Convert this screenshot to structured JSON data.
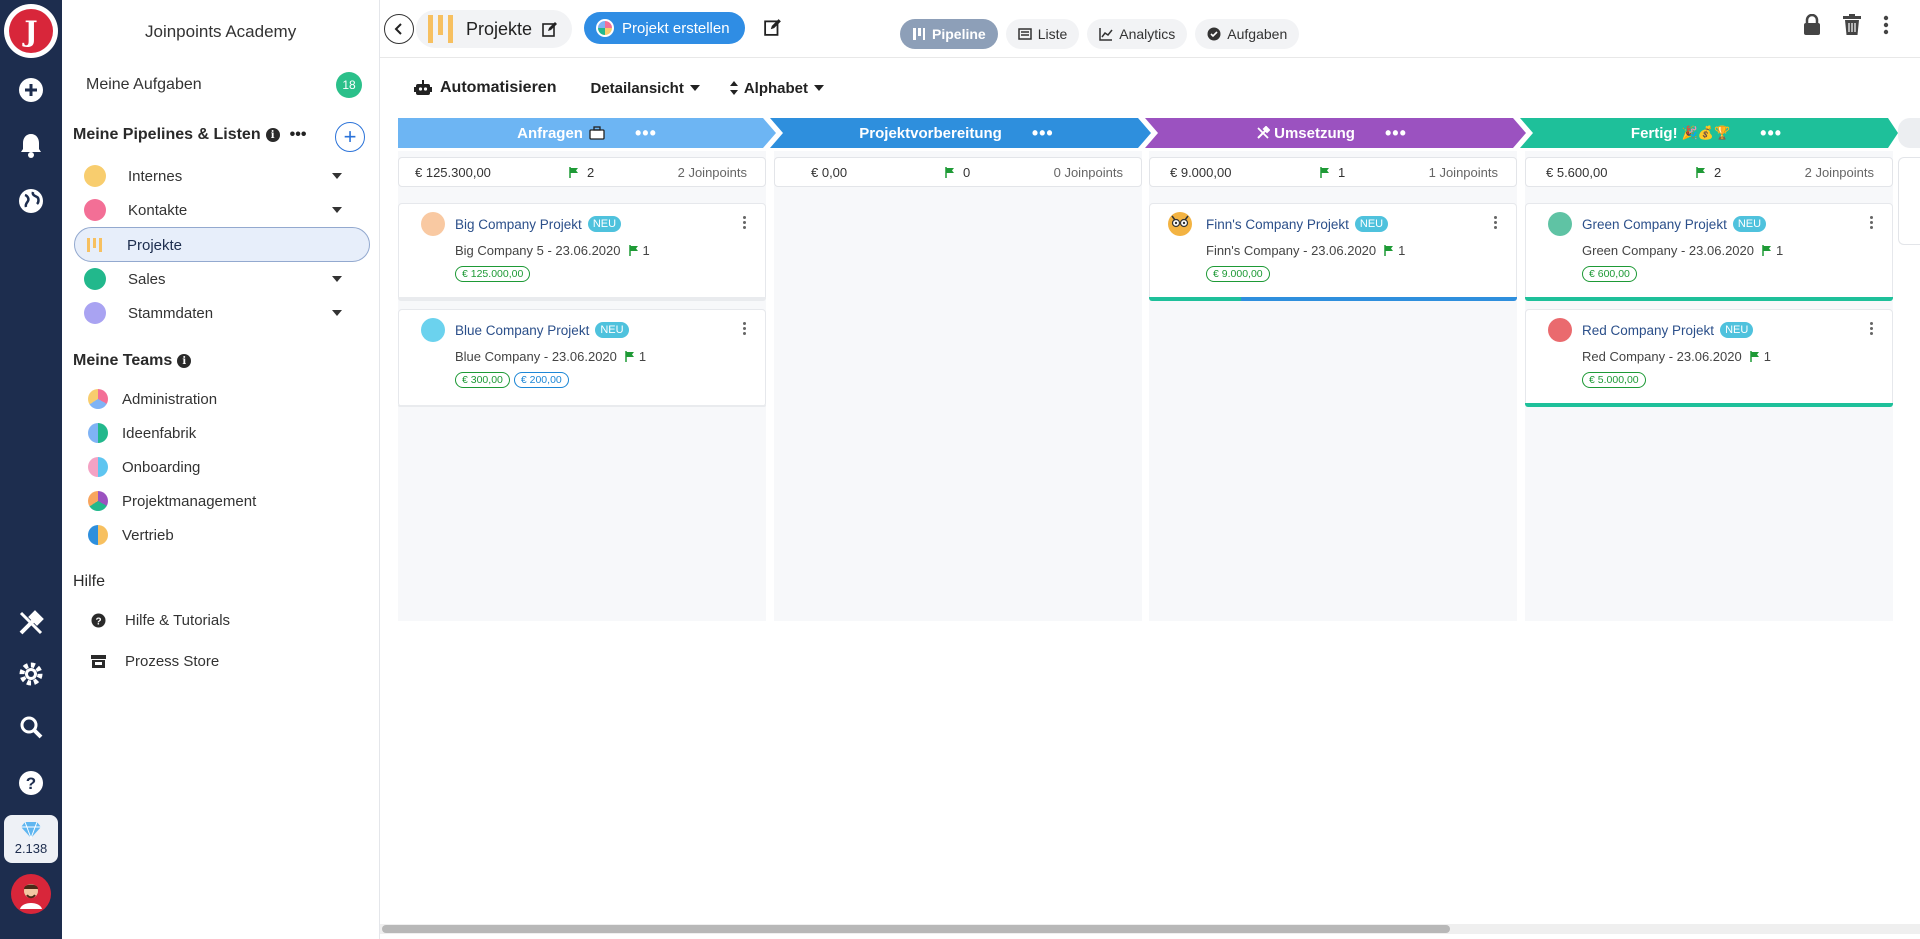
{
  "app": {
    "title": "Joinpoints Academy",
    "credits": "2.138"
  },
  "sidebar": {
    "my_tasks": {
      "label": "Meine Aufgaben",
      "count": "18"
    },
    "pipelines_heading": "Meine Pipelines & Listen",
    "pipelines": [
      {
        "label": "Internes",
        "color": "#f8cd6e"
      },
      {
        "label": "Kontakte",
        "color": "#f36f96"
      },
      {
        "label": "Projekte",
        "color": "#f7c060"
      },
      {
        "label": "Sales",
        "color": "#22b88c"
      },
      {
        "label": "Stammdaten",
        "color": "#a9a3f2"
      }
    ],
    "teams_heading": "Meine Teams",
    "teams": [
      {
        "label": "Administration"
      },
      {
        "label": "Ideenfabrik"
      },
      {
        "label": "Onboarding"
      },
      {
        "label": "Projektmanagement"
      },
      {
        "label": "Vertrieb"
      }
    ],
    "help_heading": "Hilfe",
    "help_items": [
      {
        "label": "Hilfe & Tutorials"
      },
      {
        "label": "Prozess Store"
      }
    ]
  },
  "topbar": {
    "current": "Projekte",
    "create_label": "Projekt erstellen",
    "views": [
      {
        "label": "Pipeline"
      },
      {
        "label": "Liste"
      },
      {
        "label": "Analytics"
      },
      {
        "label": "Aufgaben"
      }
    ]
  },
  "toolbar": {
    "automate": "Automatisieren",
    "view": "Detailansicht",
    "sort": "Alphabet"
  },
  "stages": [
    {
      "label": "Anfragen",
      "color": "#6db5f3",
      "amount": "€ 125.300,00",
      "count": "2",
      "jp": "2 Joinpoints"
    },
    {
      "label": "Projektvorbereitung",
      "color": "#2e8fdd",
      "amount": "€ 0,00",
      "count": "0",
      "jp": "0 Joinpoints"
    },
    {
      "label": "Umsetzung",
      "color": "#9b52c0",
      "amount": "€ 9.000,00",
      "count": "1",
      "jp": "1 Joinpoints"
    },
    {
      "label": "Fertig!",
      "color": "#1ec09a",
      "amount": "€ 5.600,00",
      "count": "2",
      "jp": "2 Joinpoints"
    }
  ],
  "cards": {
    "c1": {
      "title": "Big Company Projekt",
      "badge": "NEU",
      "sub": "Big Company 5 - 23.06.2020",
      "flags": "1",
      "tags": [
        "€ 125.000,00"
      ]
    },
    "c2": {
      "title": "Blue Company Projekt",
      "badge": "NEU",
      "sub": "Blue Company - 23.06.2020",
      "flags": "1",
      "tags": [
        "€ 300,00",
        "€ 200,00"
      ]
    },
    "c3": {
      "title": "Finn's Company Projekt",
      "badge": "NEU",
      "sub": "Finn's Company - 23.06.2020",
      "flags": "1",
      "tags": [
        "€ 9.000,00"
      ]
    },
    "c4": {
      "title": "Green Company Projekt",
      "badge": "NEU",
      "sub": "Green Company - 23.06.2020",
      "flags": "1",
      "tags": [
        "€ 600,00"
      ]
    },
    "c5": {
      "title": "Red Company Projekt",
      "badge": "NEU",
      "sub": "Red Company - 23.06.2020",
      "flags": "1",
      "tags": [
        "€ 5.000,00"
      ]
    }
  }
}
